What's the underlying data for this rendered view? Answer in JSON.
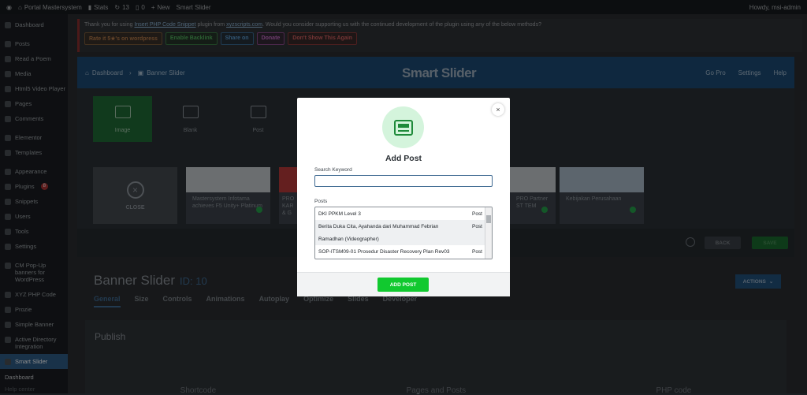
{
  "admin_bar": {
    "site_name": "Portal Mastersystem",
    "stats": "Stats",
    "updates": "13",
    "comments": "0",
    "new": "New",
    "plugin": "Smart Slider",
    "howdy": "Howdy, msi-admin"
  },
  "sidebar": {
    "items": [
      {
        "label": "Dashboard"
      },
      {
        "label": "Posts"
      },
      {
        "label": "Read a Poem"
      },
      {
        "label": "Media"
      },
      {
        "label": "Html5 Video Player"
      },
      {
        "label": "Pages"
      },
      {
        "label": "Comments"
      },
      {
        "label": "Elementor"
      },
      {
        "label": "Templates"
      },
      {
        "label": "Appearance"
      },
      {
        "label": "Plugins",
        "badge": "8"
      },
      {
        "label": "Snippets"
      },
      {
        "label": "Users"
      },
      {
        "label": "Tools"
      },
      {
        "label": "Settings"
      },
      {
        "label": "CM Pop-Up banners for WordPress"
      },
      {
        "label": "XYZ PHP Code"
      },
      {
        "label": "Prozie"
      },
      {
        "label": "Simple Banner"
      },
      {
        "label": "Active Directory Integration"
      },
      {
        "label": "Smart Slider"
      }
    ],
    "submenu": [
      "Dashboard",
      "Help center"
    ]
  },
  "notice": {
    "text_before": "Thank you for using",
    "plugin_link": "Insert PHP Code Snippet",
    "text_mid": "plugin from",
    "site_link": "xyzscripts.com",
    "text_after": ". Would you consider supporting us with the continued development of the plugin using any of the below methods?",
    "buttons": [
      "Rate it 5★'s on wordpress",
      "Enable Backlink",
      "Share on",
      "Donate",
      "Don't Show This Again"
    ]
  },
  "smart_slider": {
    "breadcrumb_home": "Dashboard",
    "breadcrumb_current": "Banner Slider",
    "logo": "Smart Slider",
    "nav": [
      "Go Pro",
      "Settings",
      "Help"
    ],
    "tiles": [
      "Image",
      "Blank",
      "Post"
    ],
    "close_label": "CLOSE",
    "slides": [
      {
        "caption": "Mastersystem Infotama achieves F5 Unity+ Platinum"
      },
      {
        "caption": "PRO KAR & G"
      },
      {
        "caption": "PRO Partner ST TEM"
      },
      {
        "caption": "Kebijakan Perusahaan"
      }
    ],
    "back": "BACK",
    "save": "SAVE"
  },
  "settings": {
    "title": "Banner Slider",
    "id_label": "ID: 10",
    "actions": "ACTIONS",
    "tabs": [
      "General",
      "Size",
      "Controls",
      "Animations",
      "Autoplay",
      "Optimize",
      "Slides",
      "Developer"
    ],
    "publish": "Publish",
    "columns": [
      "Shortcode",
      "Pages and Posts",
      "PHP code"
    ]
  },
  "modal": {
    "title": "Add Post",
    "keyword_label": "Search Keyword",
    "keyword_value": "",
    "posts_label": "Posts",
    "posts": [
      {
        "title": "DKI PPKM Level 3",
        "type": "Post"
      },
      {
        "title": "Berita Duka Cita, Ayahanda dari Muhammad Febrian",
        "type": "Post"
      },
      {
        "title": "Ramadhan (Videographer)",
        "type": ""
      },
      {
        "title": "SOP-ITSM09-01 Prosedur Disaster Recovery Plan Rev03",
        "type": "Post"
      }
    ],
    "add_button": "ADD POST",
    "close": "×"
  },
  "colors": {
    "accent": "#1d4a73",
    "green": "#11c92f"
  }
}
